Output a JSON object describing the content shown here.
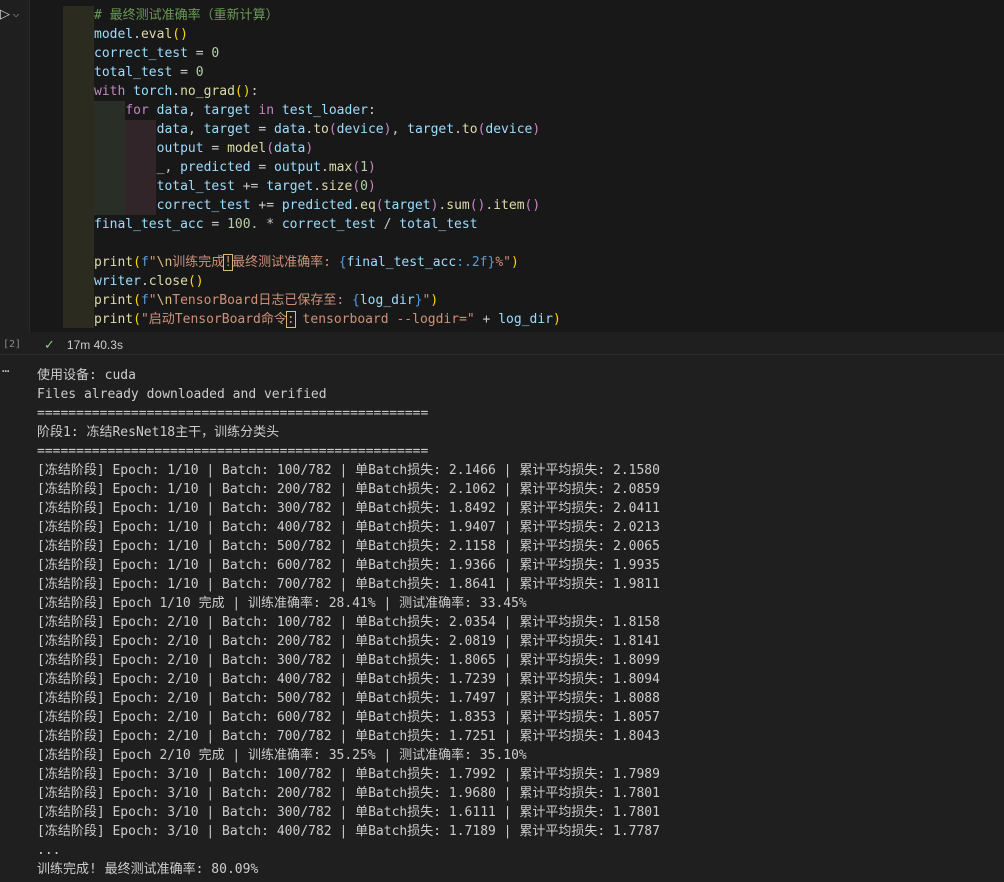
{
  "cell": {
    "execution_count": "[2]",
    "status_time": "17m 40.3s",
    "code": {
      "l1": "# 最终测试准确率（重新计算）",
      "l2_obj": "model",
      "l2_fn": "eval",
      "l2_p": "()",
      "l3_var": "correct_test",
      "l3_num": "0",
      "l4_var": "total_test",
      "l4_num": "0",
      "l5_kw": "with",
      "l5_mod": "torch",
      "l5_fn": "no_grad",
      "l5_p": "()",
      "l6_kw": "for",
      "l6_a": "data",
      "l6_b": "target",
      "l6_in": "in",
      "l6_c": "test_loader",
      "l7_a": "data",
      "l7_b": "target",
      "l7_c": "data",
      "l7_fn": "to",
      "l7_arg": "device",
      "l7_d": "target",
      "l7_fn2": "to",
      "l7_arg2": "device",
      "l8_a": "output",
      "l8_fn": "model",
      "l8_arg": "data",
      "l9_a": "_",
      "l9_b": "predicted",
      "l9_c": "output",
      "l9_fn": "max",
      "l9_num": "1",
      "l10_a": "total_test",
      "l10_b": "target",
      "l10_fn": "size",
      "l10_num": "0",
      "l11_a": "correct_test",
      "l11_b": "predicted",
      "l11_fn1": "eq",
      "l11_arg": "target",
      "l11_fn2": "sum",
      "l11_fn3": "item",
      "l12_a": "final_test_acc",
      "l12_num": "100.",
      "l12_b": "correct_test",
      "l12_c": "total_test",
      "l14_fn": "print",
      "l14_f": "f",
      "l14_s1": "\"",
      "l14_esc": "\\n",
      "l14_s2": "训练完成",
      "l14_mk": "!",
      "l14_s3": "最终测试准确率: ",
      "l14_var": "final_test_acc",
      "l14_fmt": ":.2f",
      "l14_s4": "%\"",
      "l15_obj": "writer",
      "l15_fn": "close",
      "l15_p": "()",
      "l16_fn": "print",
      "l16_f": "f",
      "l16_s1": "\"",
      "l16_esc": "\\n",
      "l16_s2": "TensorBoard日志已保存至: ",
      "l16_var": "log_dir",
      "l16_s3": "\"",
      "l17_fn": "print",
      "l17_s1": "\"启动TensorBoard命令",
      "l17_mk": ":",
      "l17_s2": " tensorboard --logdir=\"",
      "l17_var": "log_dir"
    }
  },
  "output": {
    "lines": [
      "使用设备: cuda",
      "Files already downloaded and verified",
      "==================================================",
      "阶段1: 冻结ResNet18主干，训练分类头",
      "==================================================",
      "[冻结阶段] Epoch: 1/10 | Batch: 100/782 | 单Batch损失: 2.1466 | 累计平均损失: 2.1580",
      "[冻结阶段] Epoch: 1/10 | Batch: 200/782 | 单Batch损失: 2.1062 | 累计平均损失: 2.0859",
      "[冻结阶段] Epoch: 1/10 | Batch: 300/782 | 单Batch损失: 1.8492 | 累计平均损失: 2.0411",
      "[冻结阶段] Epoch: 1/10 | Batch: 400/782 | 单Batch损失: 1.9407 | 累计平均损失: 2.0213",
      "[冻结阶段] Epoch: 1/10 | Batch: 500/782 | 单Batch损失: 2.1158 | 累计平均损失: 2.0065",
      "[冻结阶段] Epoch: 1/10 | Batch: 600/782 | 单Batch损失: 1.9366 | 累计平均损失: 1.9935",
      "[冻结阶段] Epoch: 1/10 | Batch: 700/782 | 单Batch损失: 1.8641 | 累计平均损失: 1.9811",
      "[冻结阶段] Epoch 1/10 完成 | 训练准确率: 28.41% | 测试准确率: 33.45%",
      "[冻结阶段] Epoch: 2/10 | Batch: 100/782 | 单Batch损失: 2.0354 | 累计平均损失: 1.8158",
      "[冻结阶段] Epoch: 2/10 | Batch: 200/782 | 单Batch损失: 2.0819 | 累计平均损失: 1.8141",
      "[冻结阶段] Epoch: 2/10 | Batch: 300/782 | 单Batch损失: 1.8065 | 累计平均损失: 1.8099",
      "[冻结阶段] Epoch: 2/10 | Batch: 400/782 | 单Batch损失: 1.7239 | 累计平均损失: 1.8094",
      "[冻结阶段] Epoch: 2/10 | Batch: 500/782 | 单Batch损失: 1.7497 | 累计平均损失: 1.8088",
      "[冻结阶段] Epoch: 2/10 | Batch: 600/782 | 单Batch损失: 1.8353 | 累计平均损失: 1.8057",
      "[冻结阶段] Epoch: 2/10 | Batch: 700/782 | 单Batch损失: 1.7251 | 累计平均损失: 1.8043",
      "[冻结阶段] Epoch 2/10 完成 | 训练准确率: 35.25% | 测试准确率: 35.10%",
      "[冻结阶段] Epoch: 3/10 | Batch: 100/782 | 单Batch损失: 1.7992 | 累计平均损失: 1.7989",
      "[冻结阶段] Epoch: 3/10 | Batch: 200/782 | 单Batch损失: 1.9680 | 累计平均损失: 1.7801",
      "[冻结阶段] Epoch: 3/10 | Batch: 300/782 | 单Batch损失: 1.6111 | 累计平均损失: 1.7801",
      "[冻结阶段] Epoch: 3/10 | Batch: 400/782 | 单Batch损失: 1.7189 | 累计平均损失: 1.7787",
      "...",
      "训练完成! 最终测试准确率: 80.09%"
    ]
  }
}
